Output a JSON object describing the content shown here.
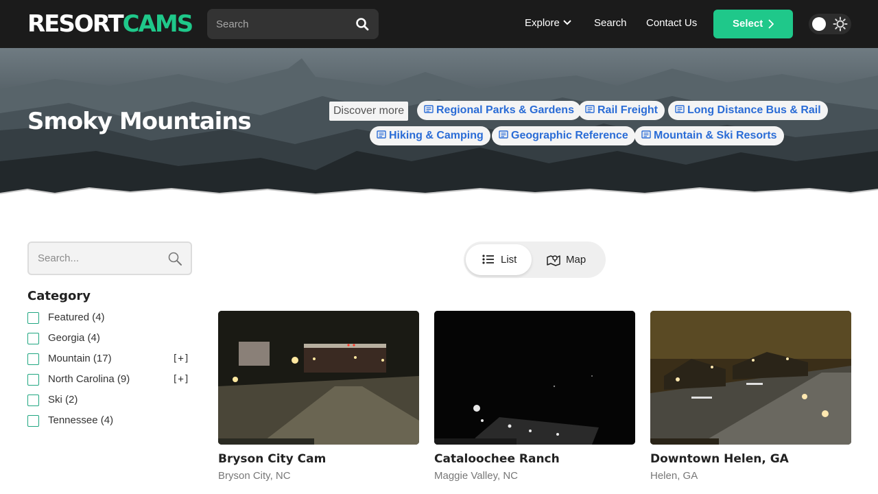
{
  "navbar": {
    "logo_part1": "RESORT",
    "logo_part2": "CAMS",
    "search_placeholder": "Search",
    "links": {
      "explore": "Explore",
      "search": "Search",
      "contact": "Contact Us"
    },
    "select_label": "Select",
    "accent_color": "#1fc88a"
  },
  "hero": {
    "title": "Smoky Mountains",
    "discover_label": "Discover more",
    "chips": [
      "Regional Parks & Gardens",
      "Rail Freight",
      "Long Distance Bus & Rail",
      "Hiking & Camping",
      "Geographic Reference",
      "Mountain & Ski Resorts"
    ],
    "chip_color": "#2a6cd6"
  },
  "sidebar": {
    "search_placeholder": "Search...",
    "category_title": "Category",
    "categories": [
      {
        "label": "Featured",
        "count": "(4)",
        "expand": ""
      },
      {
        "label": "Georgia",
        "count": "(4)",
        "expand": ""
      },
      {
        "label": "Mountain",
        "count": "(17)",
        "expand": "[+]"
      },
      {
        "label": "North Carolina",
        "count": "(9)",
        "expand": "[+]"
      },
      {
        "label": "Ski",
        "count": "(2)",
        "expand": ""
      },
      {
        "label": "Tennessee",
        "count": "(4)",
        "expand": ""
      }
    ]
  },
  "view_toggle": {
    "list_label": "List",
    "map_label": "Map",
    "active": "list"
  },
  "cams": [
    {
      "name": "Bryson City Cam",
      "location": "Bryson City, NC"
    },
    {
      "name": "Cataloochee Ranch",
      "location": "Maggie Valley, NC"
    },
    {
      "name": "Downtown Helen, GA",
      "location": "Helen, GA"
    }
  ]
}
